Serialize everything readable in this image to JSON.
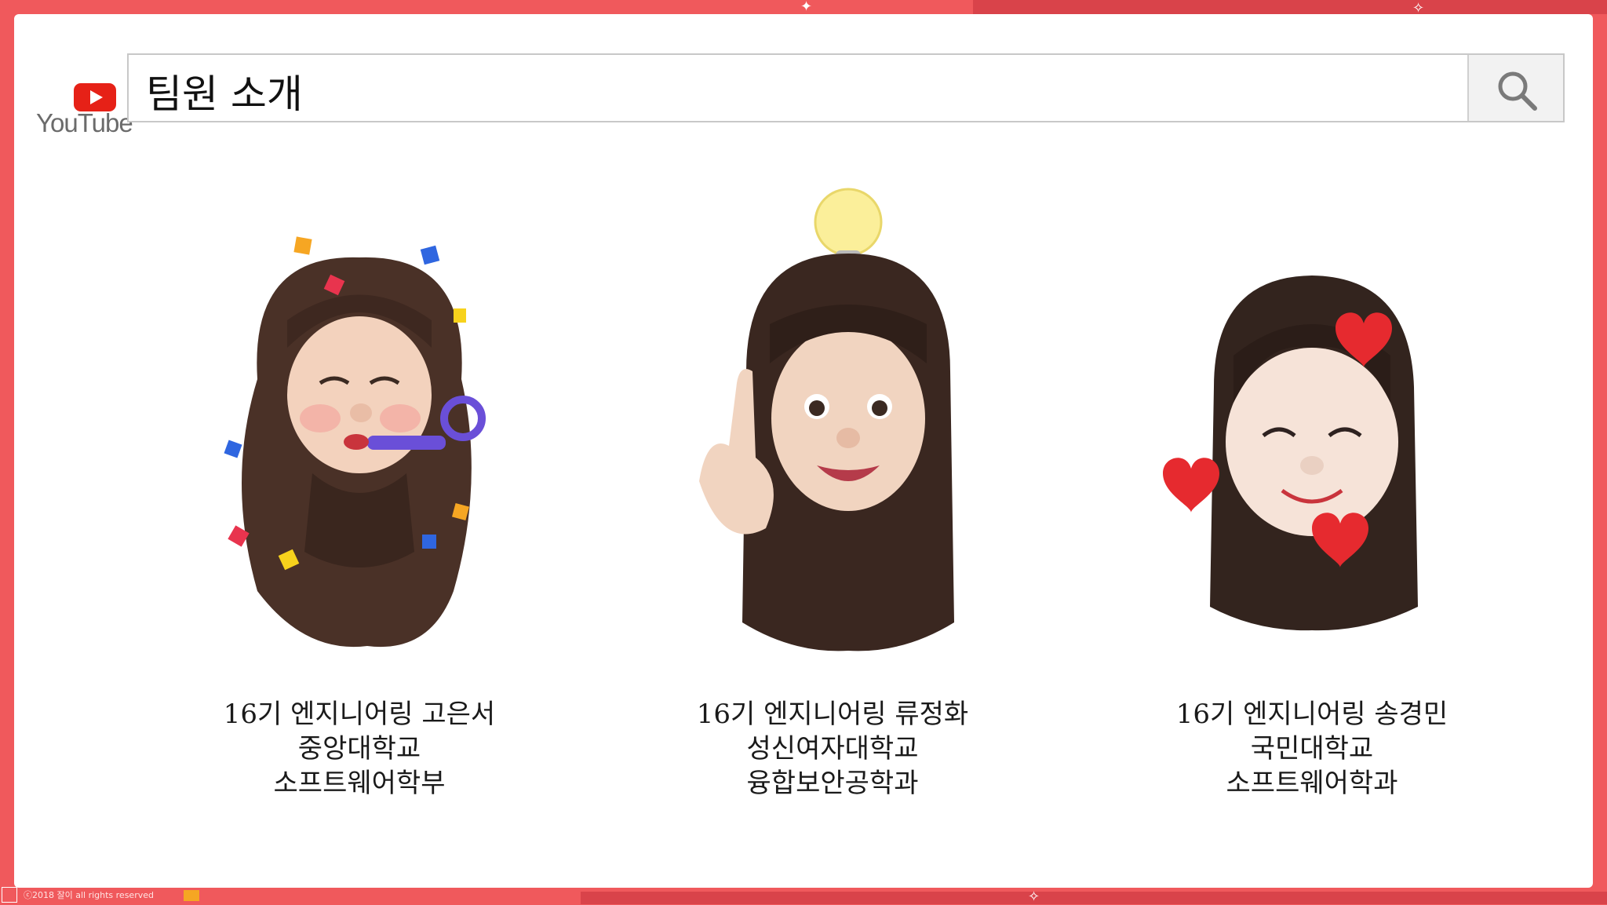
{
  "colors": {
    "frame": "#f0595c",
    "frame_dark": "#d9434a",
    "slide": "#ffffff",
    "youtube_red": "#e62117",
    "text": "#1a1a1a"
  },
  "logo": {
    "icon": "youtube-play-icon",
    "wordmark": "YouTube"
  },
  "search": {
    "query": "팀원 소개",
    "icon": "search-icon"
  },
  "members": [
    {
      "line1": "16기 엔지니어링 고은서",
      "line2": "중앙대학교",
      "line3": "소프트웨어학부",
      "avatar": "party-horn-memoji"
    },
    {
      "line1": "16기 엔지니어링 류정화",
      "line2": "성신여자대학교",
      "line3": "융합보안공학과",
      "avatar": "lightbulb-idea-memoji"
    },
    {
      "line1": "16기 엔지니어링 송경민",
      "line2": "국민대학교",
      "line3": "소프트웨어학과",
      "avatar": "hearts-smile-memoji"
    }
  ],
  "footer": {
    "copyright": "ⓒ2018 잘이 all rights reserved"
  }
}
